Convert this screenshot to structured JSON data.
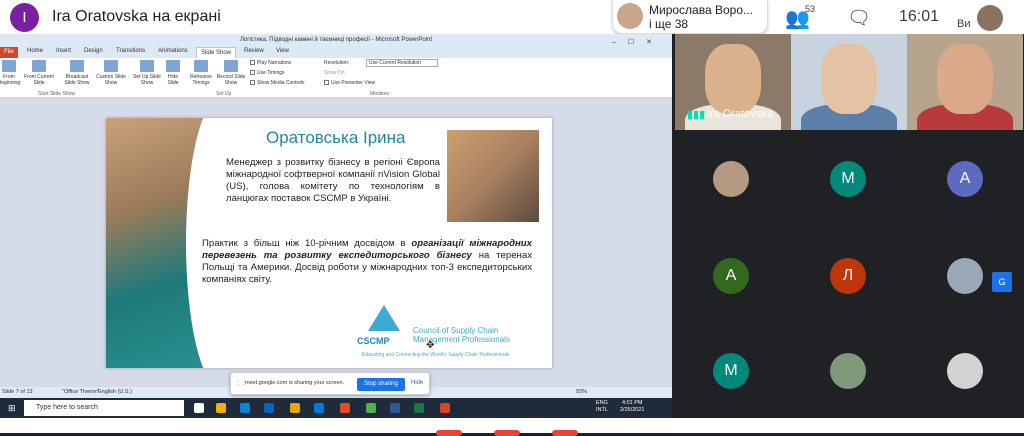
{
  "meet": {
    "presenter_initial": "I",
    "presenting_title": "Ira Oratovska на екрані",
    "raised_name": "Мирослава Воро...",
    "raised_more": "і ще 38",
    "people_count": "53",
    "time": "16:01",
    "me_label": "Ви",
    "speaker_name": "Ira Oratovska",
    "participants": [
      {
        "initial": "M",
        "color": "#00897b"
      },
      {
        "initial": "A",
        "color": "#5c6bc0"
      },
      {
        "initial": "A",
        "color": "#33691e"
      },
      {
        "initial": "Л",
        "color": "#bf360c"
      },
      {
        "initial": "M",
        "color": "#00897b"
      }
    ]
  },
  "powerpoint": {
    "window_title": "Логістика. Підводні камені й таємниці професії  -  Microsoft PowerPoint",
    "tabs": [
      "File",
      "Home",
      "Insert",
      "Design",
      "Transitions",
      "Animations",
      "Slide Show",
      "Review",
      "View"
    ],
    "ribbon_buttons": [
      "From Beginning",
      "From Current Slide",
      "Broadcast Slide Show",
      "Custom Slide Show",
      "Set Up Slide Show",
      "Hide Slide",
      "Rehearse Timings",
      "Record Slide Show"
    ],
    "groups": [
      "Start Slide Show",
      "Set Up",
      "Monitors"
    ],
    "checks": [
      "Play Narrations",
      "Use Timings",
      "Show Media Controls"
    ],
    "resolution_label": "Resolution:",
    "resolution_value": "Use Current Resolution",
    "show_on": "Show On:",
    "presenter_view": "Use Presenter View",
    "status_slide": "Slide 7 of 13",
    "status_theme": "\"Office Theme\"",
    "status_lang": "English (U.S.)",
    "status_zoom": "93%"
  },
  "slide": {
    "name": "Оратовська Ірина",
    "p1": "Менеджер з розвитку бізнесу в регіоні Європа міжнародної софтверної компанії nVision Global (US), голова комітету по технологіям в ланцюгах поставок CSCMP в Україні.",
    "p2_a": "Практик з більш ніж 10-річним досвідом в ",
    "p2_b": "організації міжнародних перевезень та розвитку експедиторського бізнесу",
    "p2_c": " на теренах Польщі та Америки. Досвід роботи у міжнародних топ-3 експедиторських компаніях світу.",
    "logo": "CSCMP",
    "council": "Council of Supply Chain Management Professionals",
    "tagline": "Educating and Connecting the World's Supply Chain Professionals"
  },
  "share_bar": {
    "message": "meet.google.com is sharing your screen.",
    "stop": "Stop sharing",
    "hide": "Hide"
  },
  "taskbar": {
    "search": "Type here to search",
    "lang1": "ENG",
    "lang2": "INTL",
    "time": "4:01 PM",
    "date": "2/25/2021"
  }
}
